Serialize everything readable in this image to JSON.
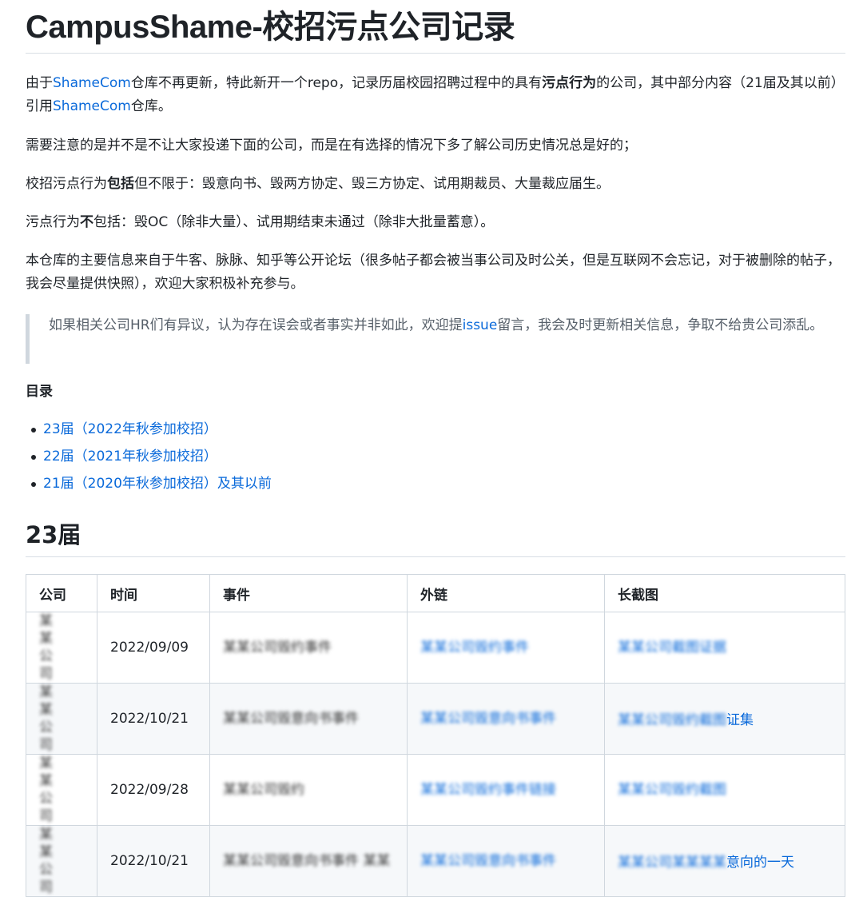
{
  "title": "CampusShame-校招污点公司记录",
  "intro": {
    "t1": "由于",
    "link1": "ShameCom",
    "t2": "仓库不再更新，特此新开一个repo，记录历届校园招聘过程中的具有",
    "bold": "污点行为",
    "t3": "的公司，其中部分内容（21届及其以前）引用",
    "link2": "ShameCom",
    "t4": "仓库。"
  },
  "note": "需要注意的是并不是不让大家投递下面的公司，而是在有选择的情况下多了解公司历史情况总是好的；",
  "include": {
    "t1": "校招污点行为",
    "bold": "包括",
    "t2": "但不限于：毁意向书、毁两方协定、毁三方协定、试用期裁员、大量裁应届生。"
  },
  "exclude": {
    "t1": "污点行为",
    "bold": "不",
    "t2": "包括：毁OC（除非大量）、试用期结束未通过（除非大批量蓄意）。"
  },
  "source": "本仓库的主要信息来自于牛客、脉脉、知乎等公开论坛（很多帖子都会被当事公司及时公关，但是互联网不会忘记，对于被删除的帖子，我会尽量提供快照），欢迎大家积极补充参与。",
  "quote": {
    "t1": "如果相关公司HR们有异议，认为存在误会或者事实并非如此，欢迎提",
    "link": "issue",
    "t2": "留言，我会及时更新相关信息，争取不给贵公司添乱。"
  },
  "toc": {
    "title": "目录",
    "items": [
      "23届（2022年秋参加校招）",
      "22届（2021年秋参加校招）",
      "21届（2020年秋参加校招）及其以前"
    ]
  },
  "section_title": "23届",
  "table": {
    "headers": [
      "公司",
      "时间",
      "事件",
      "外链",
      "长截图"
    ],
    "rows": [
      {
        "company": "某某公司",
        "date": "2022/09/09",
        "event": "某某公司毁约事件",
        "link": "某某公司毁约事件",
        "screenshot": "某某公司截图证据"
      },
      {
        "company": "某某公司",
        "date": "2022/10/21",
        "event": "某某公司毁意向书事件",
        "link": "某某公司毁意向书事件",
        "screenshot": "某某公司毁约截图",
        "screenshot_suffix": "证集"
      },
      {
        "company": "某某公司",
        "date": "2022/09/28",
        "event": "某某公司毁约",
        "link": "某某公司毁约事件链接",
        "screenshot": "某某公司毁约截图"
      },
      {
        "company": "某某公司",
        "date": "2022/10/21",
        "event": "某某公司毁意向书事件 某某",
        "link": "某某公司毁意向书事件",
        "screenshot": "某某公司某某某某",
        "screenshot_suffix": "意向的一天"
      }
    ]
  }
}
